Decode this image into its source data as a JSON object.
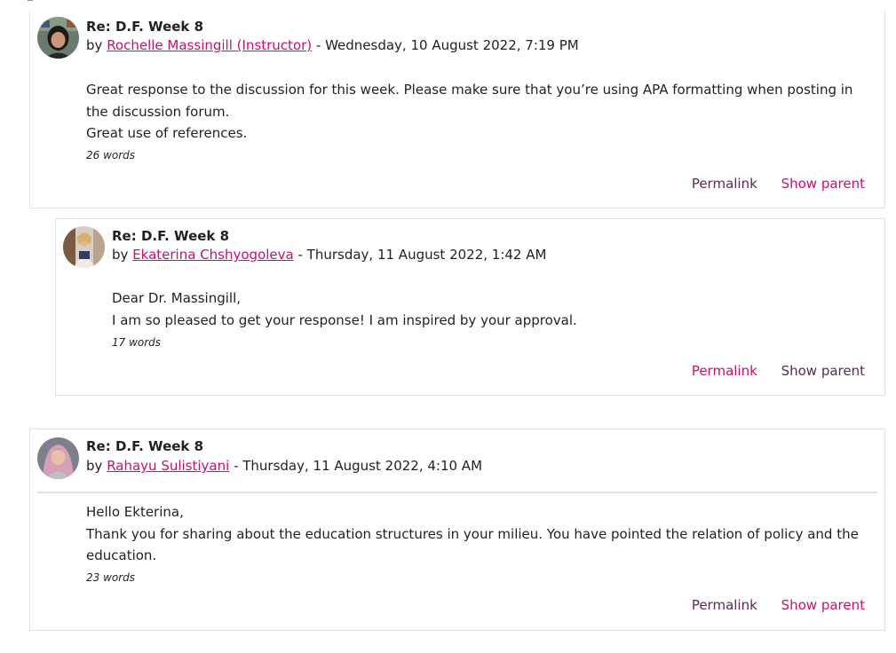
{
  "posts": [
    {
      "subject": "Re: D.F. Week 8",
      "by": "by",
      "author": "Rochelle Massingill (Instructor)",
      "date": " - Wednesday, 10 August 2022, 7:19 PM",
      "paragraphs": [
        "Great response to the discussion for this week. Please make sure that you’re using APA formatting when posting in the discussion forum.",
        "Great use of references."
      ],
      "word_count": "26 words",
      "actions": {
        "permalink": "Permalink",
        "show_parent": "Show parent"
      }
    },
    {
      "subject": "Re: D.F. Week 8",
      "by": "by",
      "author": "Ekaterina Chshyogoleva",
      "date": " - Thursday, 11 August 2022, 1:42 AM",
      "paragraphs": [
        "Dear Dr. Massingill,",
        "I am so pleased to get your response! I am inspired by your approval."
      ],
      "word_count": "17 words",
      "actions": {
        "permalink": "Permalink",
        "show_parent": "Show parent"
      }
    },
    {
      "subject": "Re: D.F. Week 8",
      "by": "by",
      "author": "Rahayu Sulistiyani",
      "date": " - Thursday, 11 August 2022, 4:10 AM",
      "paragraphs": [
        "Hello Ekterina,",
        "Thank you for sharing about the education structures in your milieu. You have pointed the relation of policy and the education."
      ],
      "word_count": "23 words",
      "actions": {
        "permalink": "Permalink",
        "show_parent": "Show parent"
      }
    }
  ],
  "colors": {
    "author_link": "#c6116d",
    "permalink": "#5a2a55",
    "border": "#dee2e6",
    "text": "#1d2125"
  }
}
